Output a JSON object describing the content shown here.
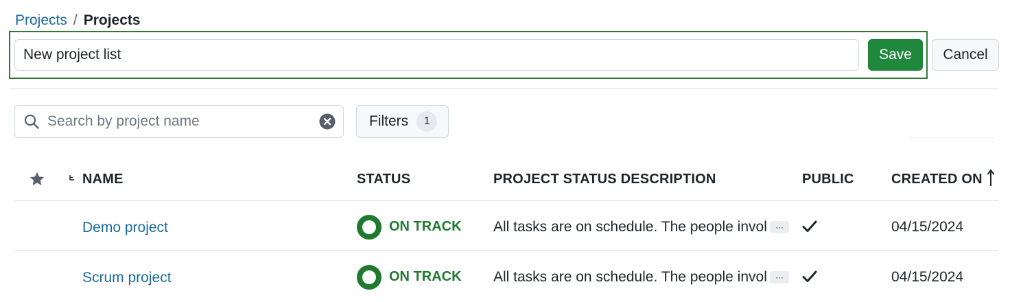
{
  "breadcrumb": {
    "parent": "Projects",
    "separator": "/",
    "current": "Projects"
  },
  "edit": {
    "name_value": "New project list",
    "save_label": "Save",
    "cancel_label": "Cancel"
  },
  "toolbar": {
    "search_placeholder": "Search by project name",
    "filters_label": "Filters",
    "filters_count": "1"
  },
  "table": {
    "columns": {
      "name": "NAME",
      "status": "STATUS",
      "description": "PROJECT STATUS DESCRIPTION",
      "public": "PUBLIC",
      "created_on": "CREATED ON"
    },
    "sort": {
      "column": "created_on",
      "direction": "ascending"
    },
    "rows": [
      {
        "name": "Demo project",
        "status": "ON TRACK",
        "description": "All tasks are on schedule. The people invol",
        "more": "···",
        "public": true,
        "created_on": "04/15/2024"
      },
      {
        "name": "Scrum project",
        "status": "ON TRACK",
        "description": "All tasks are on schedule. The people invol",
        "more": "···",
        "public": true,
        "created_on": "04/15/2024"
      }
    ]
  },
  "colors": {
    "link": "#1a6aa0",
    "primary_button": "#1f883d",
    "edit_frame_border": "#2f7a33",
    "status_on_track": "#1f7a2e"
  },
  "icons": {
    "search": "search-icon",
    "clear": "clear-icon",
    "favorite_column": "star-icon",
    "hierarchy": "hierarchy-icon",
    "sort": "sort-arrow-up-icon",
    "status": "status-ring-icon",
    "public": "checkmark-icon"
  }
}
